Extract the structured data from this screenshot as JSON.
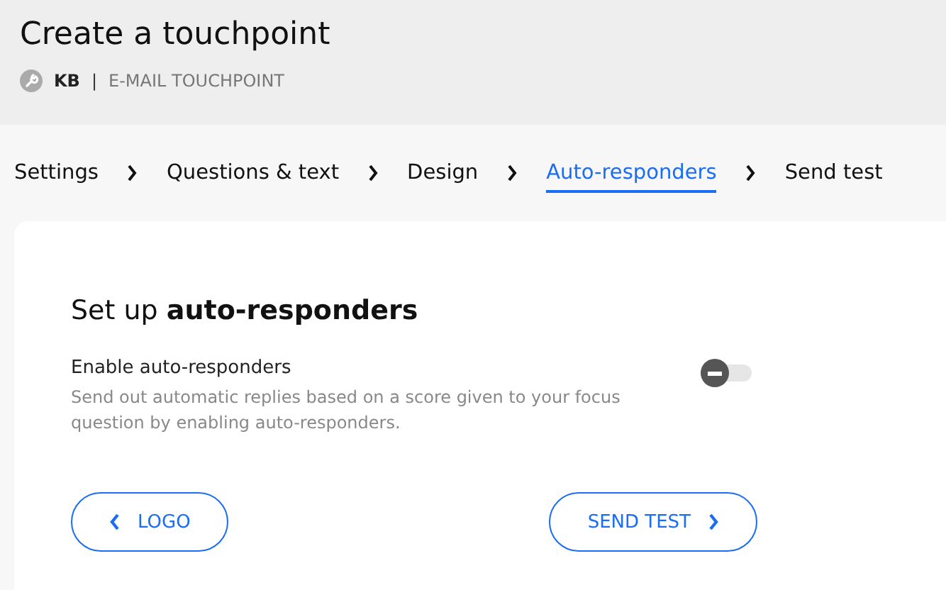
{
  "header": {
    "title": "Create a touchpoint",
    "owner": "KB",
    "separator": "|",
    "type": "E-MAIL TOUCHPOINT"
  },
  "steps": [
    {
      "label": "Settings",
      "selected": false
    },
    {
      "label": "Questions & text",
      "selected": false
    },
    {
      "label": "Design",
      "selected": false
    },
    {
      "label": "Auto-responders",
      "selected": true
    },
    {
      "label": "Send test",
      "selected": false
    }
  ],
  "card": {
    "heading": "Set up **auto-responders**",
    "setting": {
      "label": "Enable auto-responders",
      "description": "Send out automatic replies based on a score given to your focus question by enabling auto-responders.",
      "on": false
    },
    "buttons": [
      {
        "label": "LOGO",
        "kind": "back"
      },
      {
        "label": "SEND TEST",
        "kind": "next"
      }
    ]
  }
}
